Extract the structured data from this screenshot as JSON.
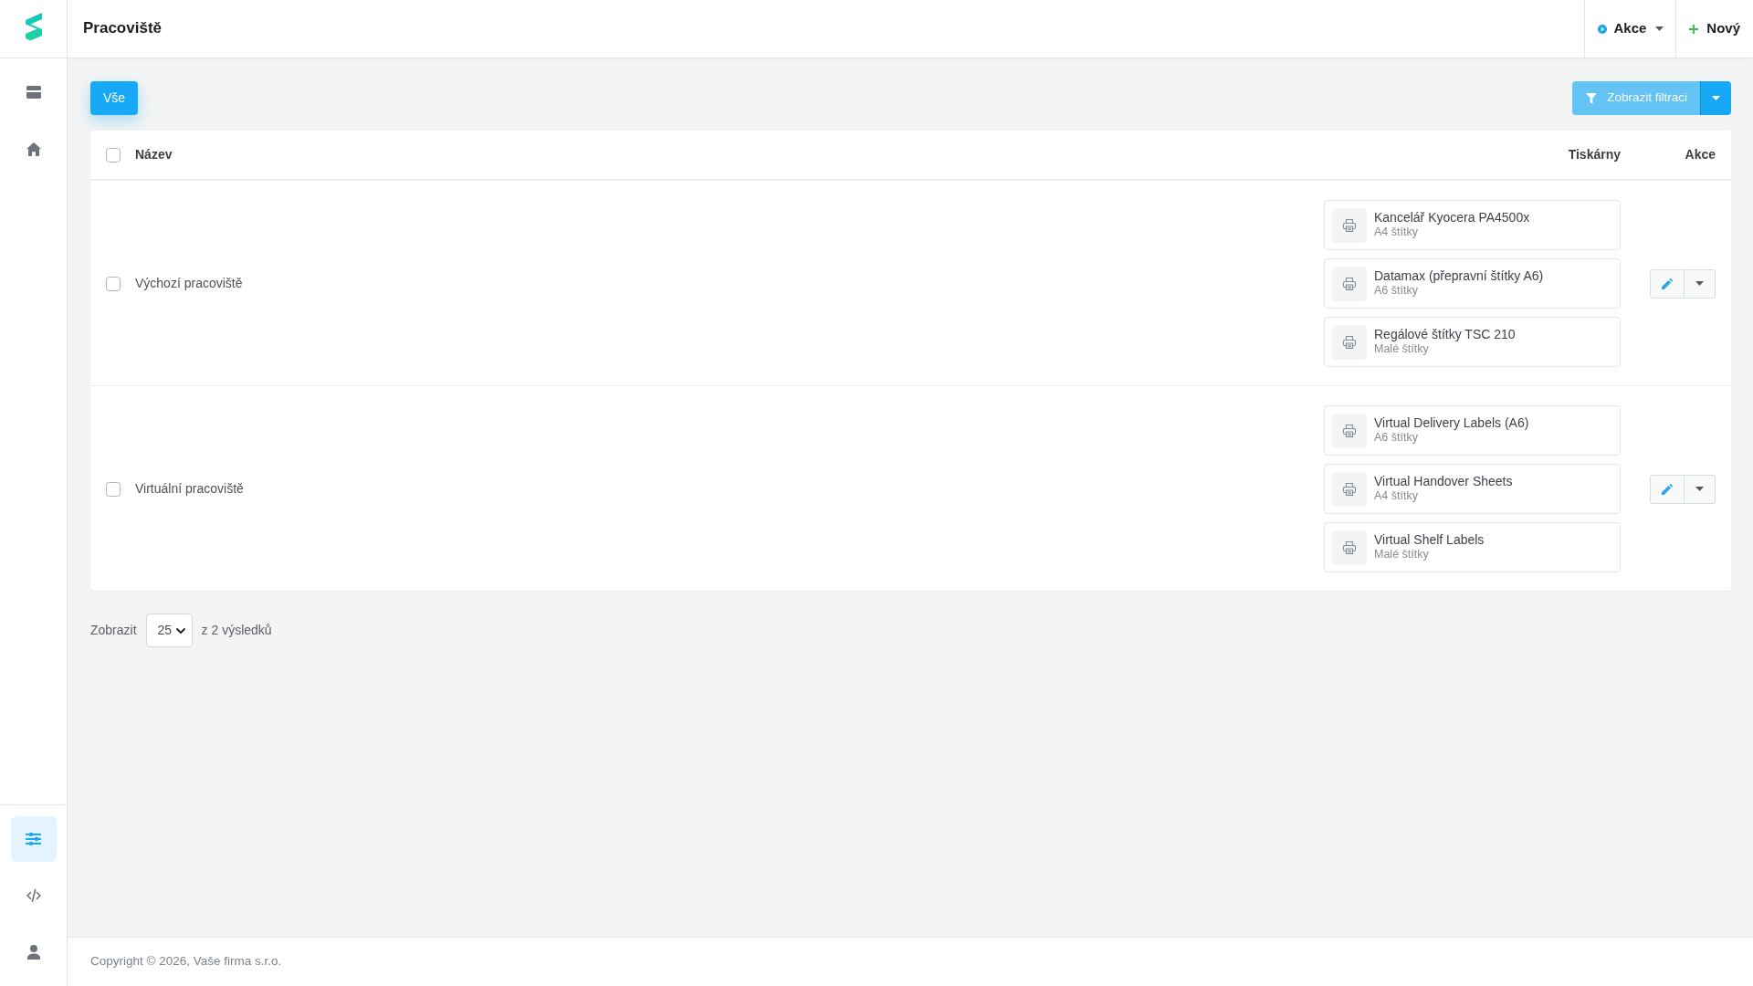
{
  "sidebar": {
    "top_items": [
      {
        "selected": false
      },
      {
        "selected": false
      }
    ],
    "bottom_items": [
      {
        "selected": true
      },
      {
        "selected": false
      },
      {
        "selected": false
      }
    ]
  },
  "header": {
    "title": "Pracoviště",
    "actions_menu": {
      "label": "Akce"
    },
    "new_button": {
      "label": "Nový"
    }
  },
  "toolbar": {
    "views": [
      {
        "label": "Vše",
        "selected": true
      }
    ],
    "filter_button": {
      "label": "Zobrazit filtraci",
      "disabled": true
    }
  },
  "table": {
    "select_all": {
      "checked": false
    },
    "columns": [
      "Název",
      "Tiskárny",
      "Akce"
    ],
    "rows": [
      {
        "checked": false,
        "name": "Výchozí pracoviště",
        "printers": [
          {
            "name": "Kancelář Kyocera PA4500x",
            "type": "A4 štítky"
          },
          {
            "name": "Datamax (přepravní štítky A6)",
            "type": "A6 štítky"
          },
          {
            "name": "Regálové štítky TSC 210",
            "type": "Malé štítky"
          }
        ]
      },
      {
        "checked": false,
        "name": "Virtuální pracoviště",
        "printers": [
          {
            "name": "Virtual Delivery Labels (A6)",
            "type": "A6 štítky"
          },
          {
            "name": "Virtual Handover Sheets",
            "type": "A4 štítky"
          },
          {
            "name": "Virtual Shelf Labels",
            "type": "Malé štítky"
          }
        ]
      }
    ]
  },
  "pagination": {
    "label": "Zobrazit",
    "page_size": "25",
    "summary": "z 2 výsledků"
  },
  "footer": {
    "text": "Copyright © 2026, Vaše firma s.r.o."
  }
}
